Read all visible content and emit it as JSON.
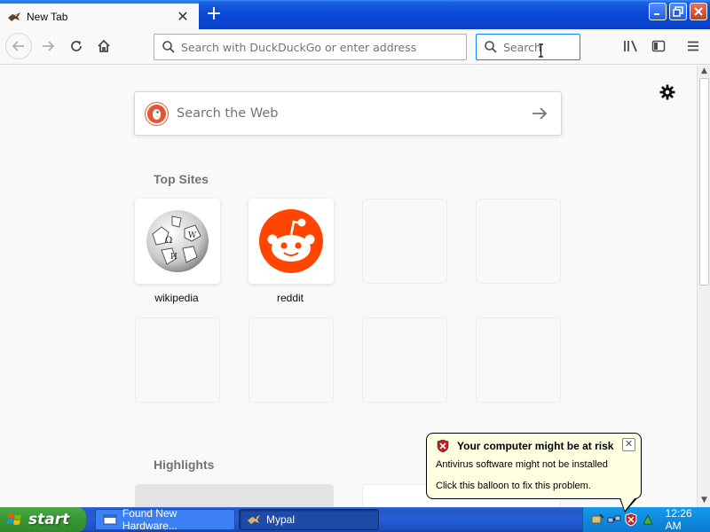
{
  "browser": {
    "tab_title": "New Tab",
    "tab_close": "✕",
    "new_tab": "+",
    "url_placeholder": "Search with DuckDuckGo or enter address",
    "search_placeholder": "Search",
    "window_buttons": {
      "minimize": "_",
      "maximize": "▭",
      "close": "✕"
    },
    "accent": "#0a84ff"
  },
  "newtab": {
    "web_search_placeholder": "Search the Web",
    "top_sites_title": "Top Sites",
    "top_sites": [
      {
        "label": "wikipedia",
        "icon": "wikipedia-globe"
      },
      {
        "label": "reddit",
        "icon": "reddit-alien"
      }
    ],
    "highlights_title": "Highlights"
  },
  "taskbar": {
    "start_label": "start",
    "tasks": [
      {
        "label": "Found New Hardware...",
        "icon": "hardware-icon"
      },
      {
        "label": "Mypal",
        "icon": "mypal-icon"
      }
    ],
    "clock": "12:26 AM"
  },
  "balloon": {
    "title": "Your computer might be at risk",
    "line1": "Antivirus software might not be installed",
    "line2": "Click this balloon to fix this problem.",
    "close": "✕"
  }
}
